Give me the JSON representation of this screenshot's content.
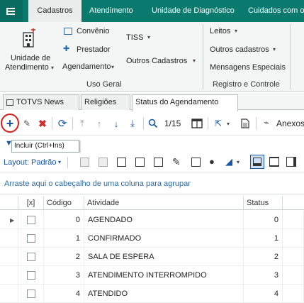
{
  "colors": {
    "brand": "#0b7a6e",
    "accent": "#1a56a8",
    "danger": "#d12b2b",
    "highlight": "#d81b1b"
  },
  "menu": {
    "tabs": [
      "Cadastros",
      "Atendimento",
      "Unidade de Diagnóstico",
      "Cuidados com o"
    ]
  },
  "ribbon": {
    "unidade_line1": "Unidade de",
    "unidade_line2": "Atendimento",
    "convenio": "Convênio",
    "prestador": "Prestador",
    "agendamento": "Agendamento",
    "tiss": "TISS",
    "outros_cadastros": "Outros Cadastros",
    "group_uso_geral": "Uso Geral",
    "leitos": "Leitos",
    "outros_cadastros2": "Outros cadastros",
    "mensagens_especiais": "Mensagens Especiais",
    "group_registro": "Registro e Controle"
  },
  "doc_tabs": [
    "TOTVS News",
    "Religiões",
    "Status do Agendamento"
  ],
  "toolbar": {
    "page_counter": "1/15",
    "anexos": "Anexos"
  },
  "tooltip": "Incluir (Ctrl+Ins)",
  "layoutbar": {
    "layout_label": "Layout:",
    "layout_value": "Padrão"
  },
  "grid": {
    "group_hint": "Arraste aqui o cabeçalho de uma coluna para agrupar",
    "headers": {
      "check": "[x]",
      "codigo": "Código",
      "atividade": "Atividade",
      "status": "Status"
    },
    "rows": [
      {
        "codigo": "0",
        "atividade": "AGENDADO",
        "status": "0"
      },
      {
        "codigo": "1",
        "atividade": "CONFIRMADO",
        "status": "1"
      },
      {
        "codigo": "2",
        "atividade": "SALA DE ESPERA",
        "status": "2"
      },
      {
        "codigo": "3",
        "atividade": "ATENDIMENTO INTERROMPIDO",
        "status": "3"
      },
      {
        "codigo": "4",
        "atividade": "ATENDIDO",
        "status": "4"
      }
    ]
  }
}
